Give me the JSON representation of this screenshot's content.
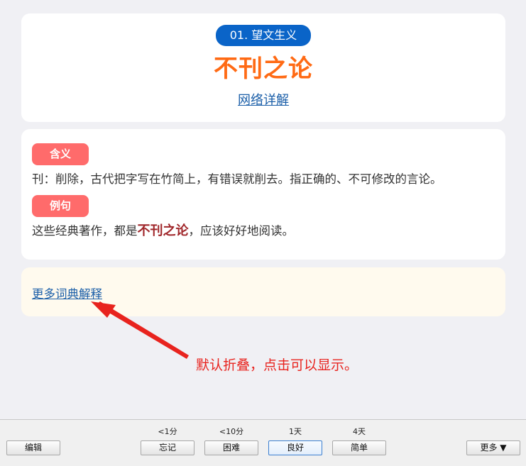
{
  "card": {
    "badge": "01. 望文生义",
    "idiom": "不刊之论",
    "detail_link": "网络详解"
  },
  "meaning": {
    "tag_meaning": "含义",
    "meaning_text": "刊：削除，古代把字写在竹简上，有错误就削去。指正确的、不可修改的言论。",
    "tag_example": "例句",
    "example_before": "这些经典著作，都是",
    "example_highlight": "不刊之论",
    "example_after": "，应该好好地阅读。"
  },
  "more": {
    "link": "更多词典解释"
  },
  "annotation": "默认折叠，点击可以显示。",
  "colors": {
    "badge": "#0a64c8",
    "idiom": "#ff6a14",
    "tag": "#ff6b6b",
    "highlight": "#a0262a",
    "annotation": "#e8231e"
  },
  "bottom_bar": {
    "edit": "编辑",
    "more": "更多 ▼",
    "answers": [
      {
        "time": "<1分",
        "label": "忘记"
      },
      {
        "time": "<10分",
        "label": "困难"
      },
      {
        "time": "1天",
        "label": "良好"
      },
      {
        "time": "4天",
        "label": "简单"
      }
    ]
  }
}
